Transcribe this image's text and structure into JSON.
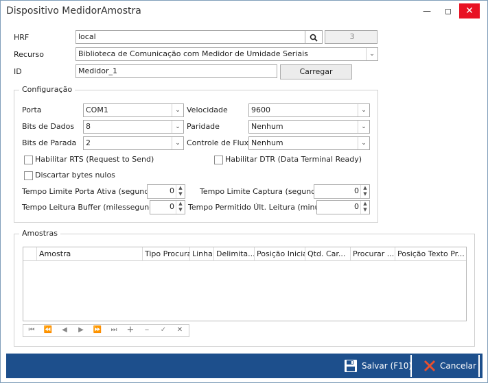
{
  "window": {
    "title": "Dispositivo MedidorAmostra"
  },
  "form": {
    "hrf_label": "HRF",
    "hrf_value": "local",
    "hrf_count": "3",
    "recurso_label": "Recurso",
    "recurso_value": "Biblioteca de Comunicação com Medidor de Umidade Seriais",
    "id_label": "ID",
    "id_value": "Medidor_1",
    "carregar_label": "Carregar"
  },
  "config": {
    "title": "Configuração",
    "porta_label": "Porta",
    "porta_value": "COM1",
    "velocidade_label": "Velocidade",
    "velocidade_value": "9600",
    "bits_dados_label": "Bits de Dados",
    "bits_dados_value": "8",
    "paridade_label": "Paridade",
    "paridade_value": "Nenhum",
    "bits_parada_label": "Bits de Parada",
    "bits_parada_value": "2",
    "controle_fluxo_label": "Controle de Fluxo",
    "controle_fluxo_value": "Nenhum",
    "rts_label": "Habilitar RTS (Request to Send)",
    "dtr_label": "Habilitar DTR (Data Terminal Ready)",
    "discartar_label": "Discartar bytes nulos",
    "tempo_porta_label": "Tempo Limite Porta Ativa (segundos)",
    "tempo_porta_value": "0",
    "tempo_captura_label": "Tempo Limite Captura (segundos)",
    "tempo_captura_value": "0",
    "tempo_buffer_label": "Tempo Leitura Buffer (milessegundos)",
    "tempo_buffer_value": "0",
    "tempo_ult_label": "Tempo Permitido Últ. Leitura (minutos)",
    "tempo_ult_value": "0"
  },
  "amostras": {
    "title": "Amostras",
    "columns": [
      "Amostra",
      "Tipo Procura",
      "Linha",
      "Delimita...",
      "Posição Inicial",
      "Qtd. Car...",
      "Procurar ...",
      "Posição Texto Pr..."
    ]
  },
  "footer": {
    "save_label": "Salvar (F10)",
    "cancel_label": "Cancelar"
  },
  "colors": {
    "footer_bg": "#1d4f8c",
    "close_btn": "#e81123",
    "cancel_icon": "#e8502e"
  }
}
